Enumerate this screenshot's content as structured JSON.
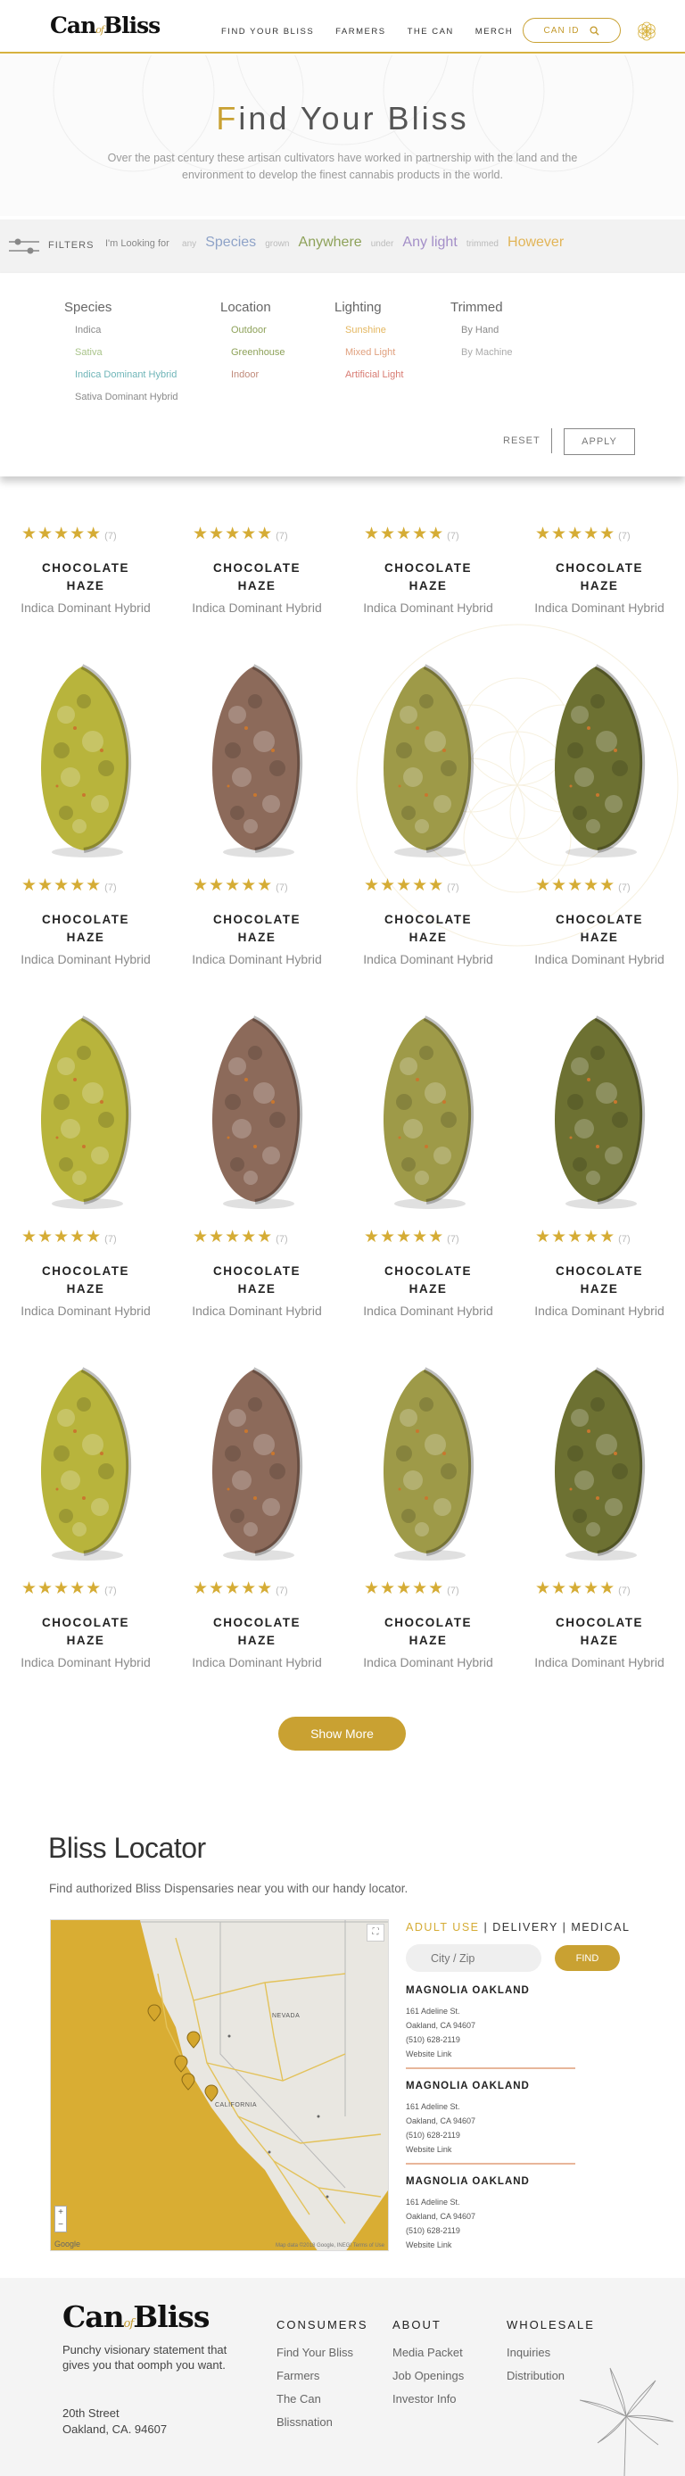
{
  "header": {
    "logo_main": "Can",
    "logo_of": "of",
    "logo_end": "Bliss",
    "nav": [
      "FIND YOUR BLISS",
      "FARMERS",
      "THE CAN",
      "MERCH"
    ],
    "canid_label": "CAN ID",
    "search_icon": "search-icon",
    "flower_icon": "flower-of-life-icon"
  },
  "hero": {
    "title_first": "F",
    "title_rest": "ind Your Bliss",
    "subtitle": "Over the past century these artisan cultivators have worked in partnership with the land and the environment to develop the finest cannabis products in the world."
  },
  "filter_bar": {
    "label": "FILTERS",
    "lead": "I'm Looking for",
    "any": "any",
    "species": "Species",
    "grown": "grown",
    "anywhere": "Anywhere",
    "under": "under",
    "any_light": "Any light",
    "trimmed": "trimmed",
    "however": "However"
  },
  "filter_panel": {
    "columns": [
      {
        "heading": "Species",
        "items": [
          "Indica",
          "Sativa",
          "Indica Dominant Hybrid",
          "Sativa Dominant Hybrid"
        ],
        "colors": [
          "#8a8a8a",
          "#a9c48a",
          "#6fb5b8",
          "#8a8a8a"
        ]
      },
      {
        "heading": "Location",
        "items": [
          "Outdoor",
          "Greenhouse",
          "Indoor"
        ],
        "colors": [
          "#8ea25a",
          "#8ea25a",
          "#c08a7a"
        ]
      },
      {
        "heading": "Lighting",
        "items": [
          "Sunshine",
          "Mixed Light",
          "Artificial Light"
        ],
        "colors": [
          "#e4b760",
          "#e0a07e",
          "#d87b72"
        ]
      },
      {
        "heading": "Trimmed",
        "items": [
          "By Hand",
          "By Machine"
        ],
        "colors": [
          "#8a8a8a",
          "#aaaaaa"
        ]
      }
    ],
    "reset": "RESET",
    "apply": "APPLY"
  },
  "products": {
    "stars": "★★★★★",
    "count": "(7)",
    "name_line1": "CHOCOLATE",
    "name_line2": "HAZE",
    "type": "Indica Dominant Hybrid",
    "rating": 5,
    "bud_colors": [
      "#b8b43c",
      "#8c6a5a",
      "#9e9a48",
      "#6d7132"
    ]
  },
  "show_more": "Show More",
  "locator": {
    "title": "Bliss Locator",
    "subtitle": "Find authorized Bliss Dispensaries near you with our handy locator.",
    "tab_adult": "ADULT USE",
    "sep": "|",
    "tab_delivery": "DELIVERY",
    "tab_medical": "MEDICAL",
    "placeholder": "City / Zip",
    "find": "FIND",
    "map_labels": {
      "nevada": "NEVADA",
      "california": "CALIFORNIA",
      "google": "Google",
      "attribution": "Map data ©2018 Google, INEGI Terms of Use",
      "zoom_in": "+",
      "zoom_out": "−",
      "fullscreen": "⛶"
    },
    "stores": [
      {
        "name": "MAGNOLIA OAKLAND",
        "street": "161 Adeline St.",
        "city": "Oakland, CA 94607",
        "phone": "(510) 628-2119",
        "link": "Website Link"
      },
      {
        "name": "MAGNOLIA OAKLAND",
        "street": "161 Adeline St.",
        "city": "Oakland, CA 94607",
        "phone": "(510) 628-2119",
        "link": "Website Link"
      },
      {
        "name": "MAGNOLIA OAKLAND",
        "street": "161 Adeline St.",
        "city": "Oakland, CA 94607",
        "phone": "(510) 628-2119",
        "link": "Website Link"
      }
    ]
  },
  "footer": {
    "tagline": "Punchy visionary statement that gives you that oomph you want.",
    "address1": "20th Street",
    "address2": "Oakland, CA. 94607",
    "consumers": {
      "heading": "CONSUMERS",
      "links": [
        "Find Your Bliss",
        "Farmers",
        "The Can",
        "Blissnation"
      ]
    },
    "about": {
      "heading": "ABOUT",
      "links": [
        "Media Packet",
        "Job Openings",
        "Investor Info"
      ]
    },
    "wholesale": {
      "heading": "WHOLESALE",
      "links": [
        "Inquiries",
        "Distribution"
      ]
    }
  }
}
